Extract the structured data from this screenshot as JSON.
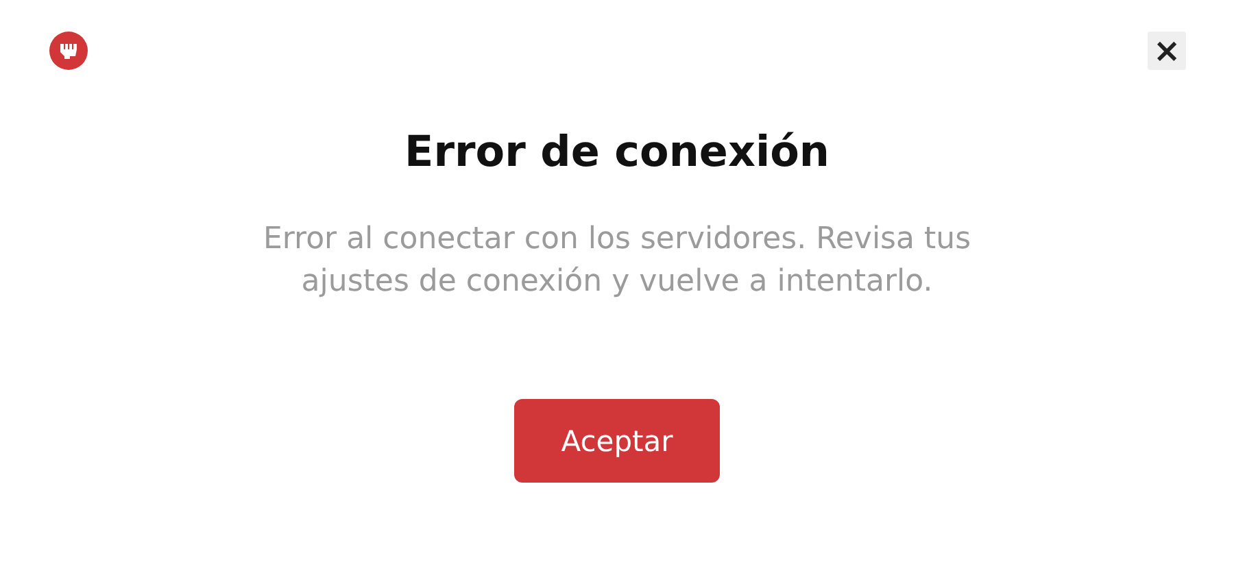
{
  "close_button": {
    "label": "×"
  },
  "dialog": {
    "title": "Error de conexión",
    "message": "Error al conectar con los servidores. Revisa tus ajustes de conexión y vuelve a intentarlo.",
    "buttons": [
      "Aceptar"
    ]
  }
}
